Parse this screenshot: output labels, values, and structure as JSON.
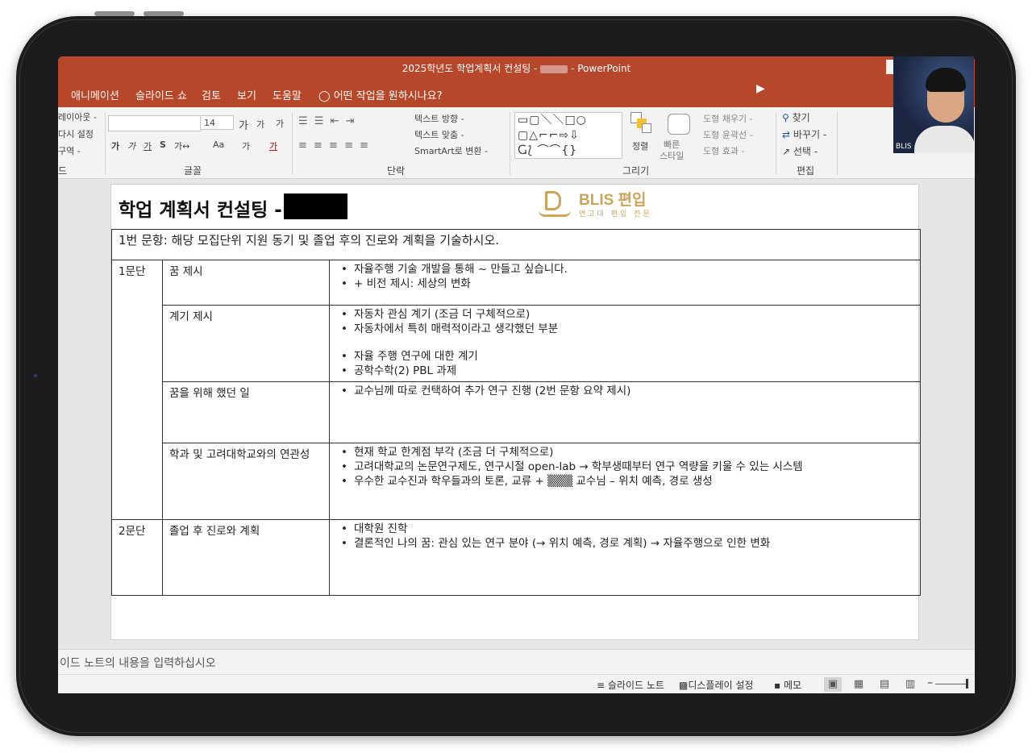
{
  "app": {
    "title_prefix": "2025학년도 학업계획서 컨설팅 - ",
    "title_suffix": " - PowerPoint"
  },
  "menu": {
    "items": [
      "애니메이션",
      "슬라이드 쇼",
      "검토",
      "보기",
      "도움말"
    ],
    "tellme": "어떤 작업을 원하시나요?"
  },
  "ribbon": {
    "slides_group": {
      "layout": "레이아웃 -",
      "reset": "다시 설정",
      "section": "구역 -",
      "label_fragment": "드"
    },
    "font_group": {
      "font_size": "14",
      "grow": "가",
      "shrink": "가",
      "clear": "가",
      "bold": "가",
      "italic": "가",
      "underline": "가",
      "strike": "S",
      "spacing": "가↔",
      "case": "Aa",
      "highlight": "가",
      "font_color": "가",
      "label": "글꼴"
    },
    "paragraph_group": {
      "text_direction": "텍스트 방향 -",
      "align_text": "텍스트 맞춤 -",
      "smartart": "SmartArt로 변환 -",
      "label": "단락"
    },
    "drawing_group": {
      "shapes_row1": "▭▢＼＼□○",
      "shapes_row2": "▢△⌐⌐⇨⇩",
      "shapes_row3": "Ⴚ⟅ ⌒⌒{}",
      "arrange": "정렬",
      "quick_styles": "빠른\n스타일",
      "fill": "도형 채우기 -",
      "outline": "도형 윤곽선 -",
      "effects": "도형 효과 -",
      "label": "그리기"
    },
    "editing_group": {
      "find": "찾기",
      "replace": "바꾸기 -",
      "select": "선택 -",
      "label": "편집"
    }
  },
  "webcam": {
    "name": "BLIS"
  },
  "slide": {
    "title": "학업 계획서 컨설팅 -",
    "logo_name": "BLIS 편입",
    "logo_sub": "연고대 편입 전문",
    "question": "1번 문항: 해당 모집단위 지원 동기 및 졸업 후의 진로와 계획을 기술하시오.",
    "rows": [
      {
        "section": "1문단",
        "topic": "꿈 제시",
        "points": [
          "자율주행 기술 개발을 통해 ~ 만들고 싶습니다.",
          "+ 비전 제시: 세상의 변화"
        ]
      },
      {
        "topic": "계기 제시",
        "points": [
          "자동차 관심 계기 (조금 더 구체적으로)",
          "자동차에서 특히 매력적이라고 생각했던 부분",
          "",
          "자율 주행 연구에 대한 계기",
          "공학수학(2) PBL 과제"
        ]
      },
      {
        "topic": "꿈을 위해 했던 일",
        "points": [
          "교수님께 따로 컨택하여 추가 연구 진행 (2번 문항 요약 제시)"
        ]
      },
      {
        "topic": "학과 및 고려대학교와의 연관성",
        "points": [
          "현재 학교 한계점 부각 (조금 더 구체적으로)",
          "고려대학교의 논문연구제도, 연구시절 open-lab → 학부생때부터 연구 역량을 키울 수 있는 시스템",
          "우수한 교수진과 학우들과의 토론, 교류 + ▒▒▒ 교수님 – 위치 예측, 경로 생성"
        ]
      },
      {
        "section": "2문단",
        "topic": "졸업 후 진로와 계획",
        "points": [
          "대학원 진학",
          "결론적인 나의 꿈: 관심 있는 연구 분야 (→ 위치 예측, 경로 계획) → 자율주행으로 인한 변화"
        ]
      }
    ]
  },
  "notes": {
    "placeholder": "이드 노트의 내용을 입력하십시오"
  },
  "status": {
    "slide_notes": "슬라이드 노트",
    "display_settings": "디스플레이 설정",
    "memo": "메모"
  }
}
